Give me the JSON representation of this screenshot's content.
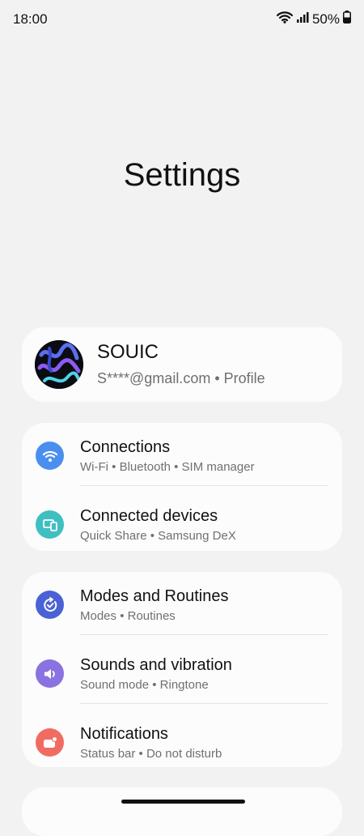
{
  "status_bar": {
    "time": "18:00",
    "battery": "50%"
  },
  "page": {
    "title": "Settings"
  },
  "profile": {
    "name": "SOUIC",
    "subtitle": "S****@gmail.com • Profile"
  },
  "groups": [
    {
      "items": [
        {
          "title": "Connections",
          "subtitle": "Wi-Fi • Bluetooth • SIM manager",
          "icon": "wifi-icon",
          "color": "#4a8ff0"
        },
        {
          "title": "Connected devices",
          "subtitle": "Quick Share • Samsung DeX",
          "icon": "connected-devices-icon",
          "color": "#3fbfc0"
        }
      ]
    },
    {
      "items": [
        {
          "title": "Modes and Routines",
          "subtitle": "Modes • Routines",
          "icon": "modes-routines-icon",
          "color": "#4a62d6"
        },
        {
          "title": "Sounds and vibration",
          "subtitle": "Sound mode • Ringtone",
          "icon": "volume-icon",
          "color": "#8a72e0"
        },
        {
          "title": "Notifications",
          "subtitle": "Status bar • Do not disturb",
          "icon": "notifications-icon",
          "color": "#f06c62"
        }
      ]
    }
  ]
}
